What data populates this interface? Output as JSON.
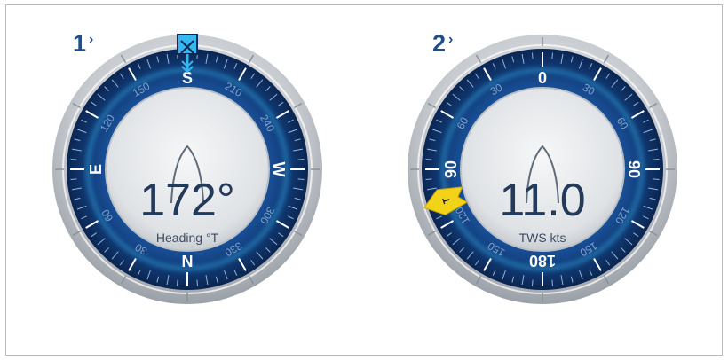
{
  "gauges": [
    {
      "callout": "1",
      "value": "172°",
      "label": "Heading °T",
      "rotation_deg": 180,
      "ring_labels": [
        {
          "text": "N",
          "angle": 0,
          "type": "cardinal"
        },
        {
          "text": "30",
          "angle": 30,
          "type": "minor"
        },
        {
          "text": "60",
          "angle": 60,
          "type": "minor"
        },
        {
          "text": "E",
          "angle": 90,
          "type": "cardinal"
        },
        {
          "text": "120",
          "angle": 120,
          "type": "minor"
        },
        {
          "text": "150",
          "angle": 150,
          "type": "minor"
        },
        {
          "text": "S",
          "angle": 180,
          "type": "cardinal"
        },
        {
          "text": "210",
          "angle": 210,
          "type": "minor"
        },
        {
          "text": "240",
          "angle": 240,
          "type": "minor"
        },
        {
          "text": "W",
          "angle": 270,
          "type": "cardinal"
        },
        {
          "text": "300",
          "angle": 300,
          "type": "minor"
        },
        {
          "text": "330",
          "angle": 330,
          "type": "minor"
        }
      ],
      "marker": {
        "type": "waypoint-box",
        "angle": 0,
        "color": "#36b7f0"
      }
    },
    {
      "callout": "2",
      "value": "11.0",
      "label": "TWS kts",
      "rotation_deg": 0,
      "ring_labels": [
        {
          "text": "0",
          "angle": 0,
          "type": "cardinal"
        },
        {
          "text": "30",
          "angle": 30,
          "type": "minor"
        },
        {
          "text": "60",
          "angle": 60,
          "type": "minor"
        },
        {
          "text": "90",
          "angle": 90,
          "type": "cardinal"
        },
        {
          "text": "120",
          "angle": 120,
          "type": "minor"
        },
        {
          "text": "150",
          "angle": 150,
          "type": "minor"
        },
        {
          "text": "180",
          "angle": 180,
          "type": "cardinal"
        },
        {
          "text": "150",
          "angle": 210,
          "type": "minor"
        },
        {
          "text": "120",
          "angle": 240,
          "type": "minor"
        },
        {
          "text": "90",
          "angle": 270,
          "type": "cardinal"
        },
        {
          "text": "60",
          "angle": 300,
          "type": "minor"
        },
        {
          "text": "30",
          "angle": 330,
          "type": "minor"
        }
      ],
      "marker": {
        "type": "wind-pointer",
        "angle": 252,
        "label": "T",
        "color": "#f3d21a"
      }
    }
  ],
  "colors": {
    "ring_dark": "#0d2a57",
    "ring_blue": "#1d5aa8",
    "ring_glow": "#36b7f0",
    "bezel": "#c9cdd2",
    "face": "#e9ebed",
    "callout": "#1f4e8c"
  }
}
